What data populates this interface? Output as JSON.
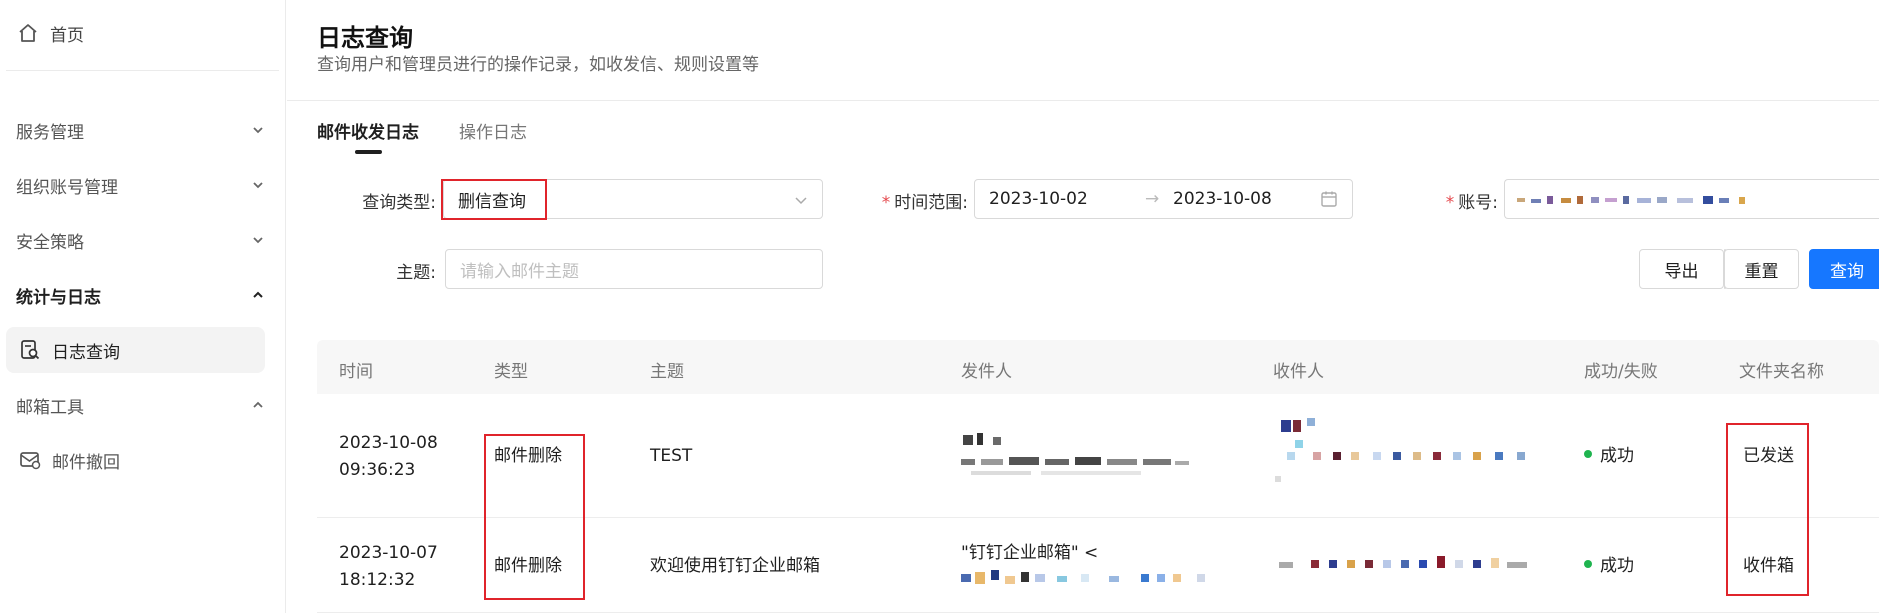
{
  "sidebar": {
    "home": "首页",
    "groups": [
      {
        "label": "服务管理",
        "expanded": false
      },
      {
        "label": "组织账号管理",
        "expanded": false
      },
      {
        "label": "安全策略",
        "expanded": false
      },
      {
        "label": "统计与日志",
        "expanded": true
      },
      {
        "label": "邮箱工具",
        "expanded": true
      }
    ],
    "items": [
      {
        "label": "日志查询",
        "selected": true,
        "icon": "log-search-icon"
      },
      {
        "label": "邮件撤回",
        "selected": false,
        "icon": "mail-recall-icon"
      }
    ]
  },
  "header": {
    "title": "日志查询",
    "subtitle": "查询用户和管理员进行的操作记录，如收发信、规则设置等"
  },
  "tabs": [
    {
      "label": "邮件收发日志",
      "active": true
    },
    {
      "label": "操作日志",
      "active": false
    }
  ],
  "filters": {
    "query_type_label": "查询类型:",
    "query_type_value": "删信查询",
    "time_range_label": "时间范围:",
    "time_start": "2023-10-02",
    "time_end": "2023-10-08",
    "time_separator": "→",
    "account_label": "账号:",
    "subject_label": "主题:",
    "subject_placeholder": "请输入邮件主题"
  },
  "actions": {
    "export": "导出",
    "reset": "重置",
    "search": "查询"
  },
  "table": {
    "columns": [
      "时间",
      "类型",
      "主题",
      "发件人",
      "收件人",
      "成功/失败",
      "文件夹名称"
    ],
    "rows": [
      {
        "date": "2023-10-08",
        "time": "09:36:23",
        "type": "邮件删除",
        "subject": "TEST",
        "sender_line1": "",
        "status": "成功",
        "folder": "已发送"
      },
      {
        "date": "2023-10-07",
        "time": "18:12:32",
        "type": "邮件删除",
        "subject": "欢迎使用钉钉企业邮箱",
        "sender_line1": "\"钉钉企业邮箱\" <",
        "status": "成功",
        "folder": "收件箱"
      }
    ]
  },
  "colors": {
    "accent": "#1677ff",
    "success": "#1fb44f",
    "highlight": "#e0242b"
  }
}
